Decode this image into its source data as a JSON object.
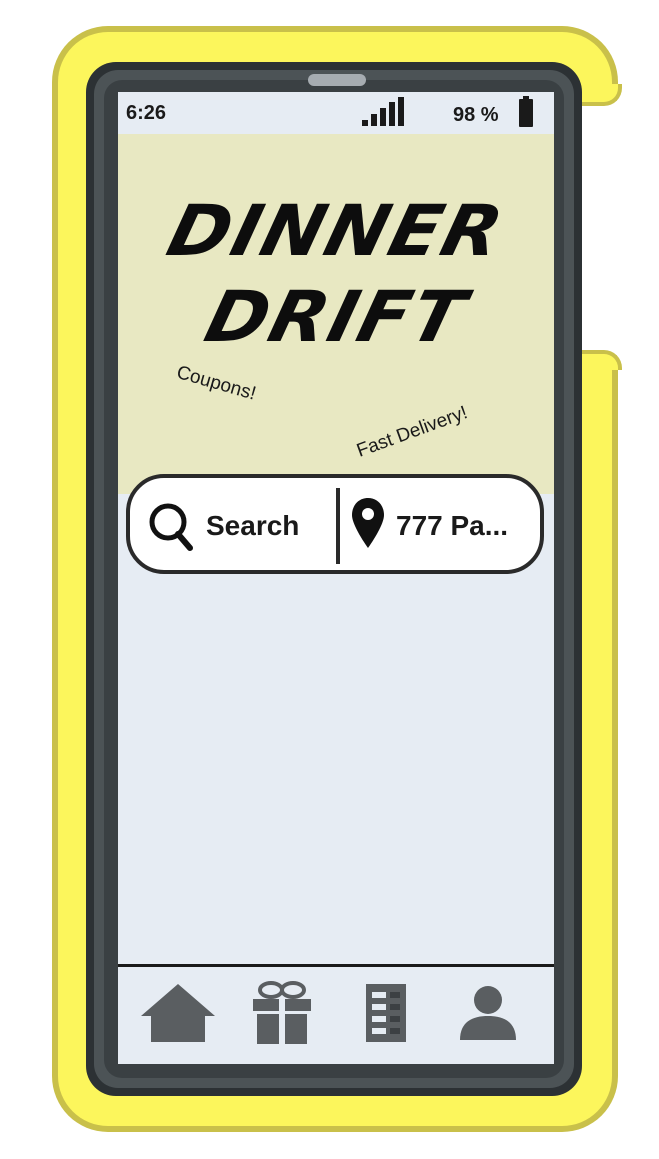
{
  "status_bar": {
    "time": "6:26",
    "battery": "98 %"
  },
  "hero": {
    "brand_line_1": "DINNER",
    "brand_line_2": "DRIFT",
    "tag_coupons": "Coupons!",
    "tag_fast_delivery": "Fast Delivery!"
  },
  "search_bar": {
    "search_label": "Search",
    "location_label": "777 Pa..."
  },
  "nav": {
    "items": [
      {
        "icon": "home-icon"
      },
      {
        "icon": "gift-icon"
      },
      {
        "icon": "orders-icon"
      },
      {
        "icon": "profile-icon"
      }
    ]
  },
  "colors": {
    "case_yellow": "#fcf65c",
    "hero_background": "#e8e8c2",
    "screen_background": "#e6ecf3",
    "nav_icon": "#5a5e61"
  }
}
